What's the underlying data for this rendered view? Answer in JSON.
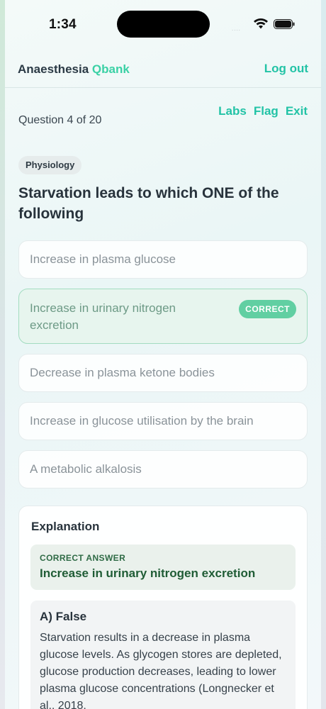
{
  "status_bar": {
    "time": "1:34",
    "dots": "....",
    "icons": [
      "wifi-icon",
      "battery-icon"
    ]
  },
  "header": {
    "brand_main": "Anaesthesia ",
    "brand_accent": "Qbank",
    "logout": "Log out"
  },
  "question": {
    "counter": "Question 4 of 20",
    "links": {
      "labs": "Labs",
      "flag": "Flag",
      "exit": "Exit"
    },
    "tag": "Physiology",
    "text": "Starvation leads to which ONE of the following"
  },
  "options": [
    {
      "label": "Increase in plasma glucose"
    },
    {
      "label": "Increase in urinary nitrogen excretion",
      "badge": "CORRECT"
    },
    {
      "label": "Decrease in plasma ketone bodies"
    },
    {
      "label": "Increase in glucose utilisation by the brain"
    },
    {
      "label": "A metabolic alkalosis"
    }
  ],
  "explanation": {
    "title": "Explanation",
    "correct_label": "CORRECT ANSWER",
    "correct_value": "Increase in urinary nitrogen excretion",
    "a_title": "A) False",
    "a_text": "Starvation results in a decrease in plasma glucose levels. As glycogen stores are depleted, glucose production decreases, leading to lower plasma glucose concentrations (Longnecker et al., 2018,"
  },
  "colors": {
    "accent": "#22c3a6",
    "correct_bg": "#e7f5ee",
    "badge": "#61cfa2"
  }
}
